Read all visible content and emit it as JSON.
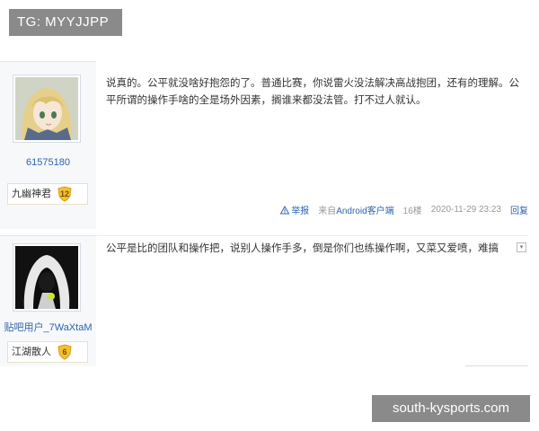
{
  "overlay": {
    "tg_label": "TG: MYYJJPP",
    "watermark": "south-kysports.com"
  },
  "posts": [
    {
      "username": "61575180",
      "badge_name": "九幽神君",
      "level": "12",
      "content": "说真的。公平就没啥好抱怨的了。普通比赛，你说雷火没法解决高战抱团，还有的理解。公平所谓的操作手啥的全是场外因素，搁谁来都没法管。打不过人就认。",
      "meta": {
        "report": "举报",
        "source_prefix": "来自",
        "source_name": "Android客户端",
        "floor": "16楼",
        "time": "2020-11-29 23:23",
        "reply": "回复"
      }
    },
    {
      "username": "贴吧用户_7WaXtaM",
      "badge_name": "江湖散人",
      "level": "6",
      "content": "公平是比的团队和操作把，说别人操作手多，倒是你们也练操作啊，又菜又爱喷，难搞"
    }
  ],
  "colors": {
    "link": "#2d64b3",
    "sidebar_bg": "#f7f8fa",
    "overlay_bg": "#8a8a8a"
  }
}
